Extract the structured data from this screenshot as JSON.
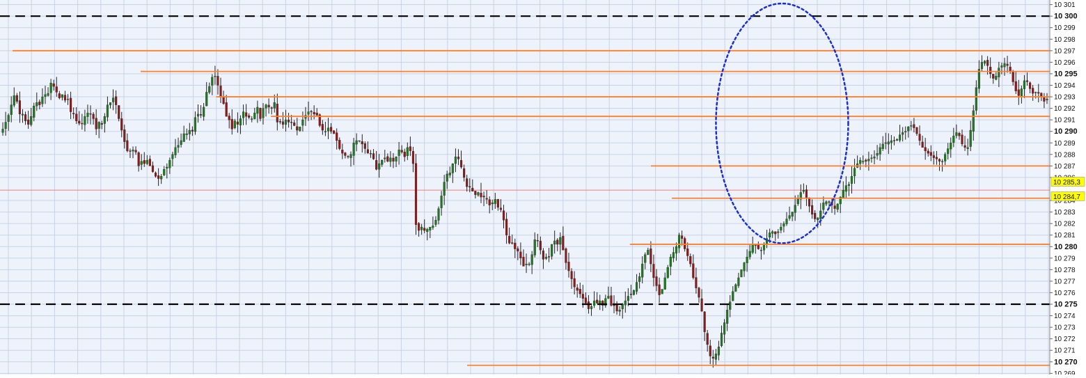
{
  "chart_data": {
    "type": "candlestick",
    "title": "",
    "xlabel": "",
    "ylabel": "",
    "ylim": [
      10268.9,
      10301.4
    ],
    "y_ticks": [
      {
        "value": 10301,
        "label": "10 301",
        "bold": false
      },
      {
        "value": 10300,
        "label": "10 300",
        "bold": true
      },
      {
        "value": 10299,
        "label": "10 299",
        "bold": false
      },
      {
        "value": 10298,
        "label": "10 298",
        "bold": false
      },
      {
        "value": 10297,
        "label": "10 297",
        "bold": false
      },
      {
        "value": 10296,
        "label": "10 296",
        "bold": false
      },
      {
        "value": 10295,
        "label": "10 295",
        "bold": true
      },
      {
        "value": 10294,
        "label": "10 294",
        "bold": false
      },
      {
        "value": 10293,
        "label": "10 293",
        "bold": false
      },
      {
        "value": 10292,
        "label": "10 292",
        "bold": false
      },
      {
        "value": 10291,
        "label": "10 291",
        "bold": false
      },
      {
        "value": 10290,
        "label": "10 290",
        "bold": true
      },
      {
        "value": 10289,
        "label": "10 289",
        "bold": false
      },
      {
        "value": 10288,
        "label": "10 288",
        "bold": false
      },
      {
        "value": 10287,
        "label": "10 287",
        "bold": false
      },
      {
        "value": 10286,
        "label": "10 286",
        "bold": false
      },
      {
        "value": 10284,
        "label": "10 284",
        "bold": false
      },
      {
        "value": 10283,
        "label": "10 283",
        "bold": false
      },
      {
        "value": 10282,
        "label": "10 282",
        "bold": false
      },
      {
        "value": 10281,
        "label": "10 281",
        "bold": false
      },
      {
        "value": 10280,
        "label": "10 280",
        "bold": true
      },
      {
        "value": 10279,
        "label": "10 279",
        "bold": false
      },
      {
        "value": 10278,
        "label": "10 278",
        "bold": false
      },
      {
        "value": 10277,
        "label": "10 277",
        "bold": false
      },
      {
        "value": 10276,
        "label": "10 276",
        "bold": false
      },
      {
        "value": 10275,
        "label": "10 275",
        "bold": true
      },
      {
        "value": 10274,
        "label": "10 274",
        "bold": false
      },
      {
        "value": 10273,
        "label": "10 273",
        "bold": false
      },
      {
        "value": 10272,
        "label": "10 272",
        "bold": false
      },
      {
        "value": 10271,
        "label": "10 271",
        "bold": false
      },
      {
        "value": 10270,
        "label": "10 270",
        "bold": true
      },
      {
        "value": 10269,
        "label": "10 269",
        "bold": false
      }
    ],
    "price_markers": [
      {
        "value": 10285.3,
        "label": "10 285,3"
      },
      {
        "value": 10284.7,
        "label": "10 284,7"
      }
    ],
    "dashed_levels": [
      10300,
      10275
    ],
    "horizontal_levels": [
      {
        "value": 10297,
        "x_start_frac": 0.012
      },
      {
        "value": 10295.2,
        "x_start_frac": 0.134
      },
      {
        "value": 10293,
        "x_start_frac": 0.206
      },
      {
        "value": 10291.3,
        "x_start_frac": 0.258
      },
      {
        "value": 10287,
        "x_start_frac": 0.62
      },
      {
        "value": 10284.2,
        "x_start_frac": 0.64
      },
      {
        "value": 10280.2,
        "x_start_frac": 0.6
      },
      {
        "value": 10269.7,
        "x_start_frac": 0.445
      }
    ],
    "price_line": 10284.9,
    "ellipse": {
      "x_center_frac": 0.745,
      "y_center": 10290.7,
      "x_radius_frac": 0.063,
      "y_radius": 10.4
    },
    "colors": {
      "background": "#eef2fb",
      "grid": "#c8d2e6",
      "level": "#ff7f2a",
      "dashed": "#000000",
      "ellipse": "#1a2fd6",
      "up": "#1d7a1d",
      "down": "#8b1a1a",
      "wick": "#222222",
      "marker_bg": "#ffff00",
      "price_line": "#e88080"
    },
    "candles": {
      "count": 380,
      "close": [
        10290.2,
        10290.8,
        10291.4,
        10292.3,
        10293.1,
        10292.6,
        10291.5,
        10291.5,
        10290.9,
        10290.6,
        10291.3,
        10292.2,
        10292.5,
        10292.3,
        10293.0,
        10293.2,
        10293.3,
        10294.2,
        10293.9,
        10293.4,
        10292.9,
        10293.2,
        10292.7,
        10292.8,
        10291.7,
        10291.5,
        10290.9,
        10290.7,
        10290.7,
        10291.3,
        10291.6,
        10291.5,
        10291.1,
        10290.2,
        10290.8,
        10290.6,
        10291.3,
        10292.3,
        10292.5,
        10292.9,
        10292.3,
        10291.1,
        10290.1,
        10289.1,
        10288.3,
        10288.3,
        10288.4,
        10288.2,
        10287.0,
        10287.4,
        10287.2,
        10287.5,
        10287.0,
        10286.5,
        10286.1,
        10285.9,
        10286.1,
        10286.7,
        10286.9,
        10287.5,
        10288.0,
        10288.6,
        10288.8,
        10289.2,
        10289.8,
        10289.8,
        10290.1,
        10290.0,
        10291.2,
        10291.5,
        10291.4,
        10292.1,
        10293.4,
        10293.9,
        10294.7,
        10294.8,
        10294.0,
        10293.0,
        10292.4,
        10291.3,
        10291.0,
        10290.2,
        10290.9,
        10290.6,
        10291.1,
        10291.7,
        10291.3,
        10291.2,
        10291.1,
        10291.6,
        10292.1,
        10291.1,
        10292.0,
        10292.3,
        10292.1,
        10292.0,
        10292.5,
        10290.8,
        10290.8,
        10290.6,
        10291.0,
        10290.8,
        10290.8,
        10290.5,
        10290.1,
        10290.4,
        10291.0,
        10291.4,
        10291.7,
        10291.7,
        10291.5,
        10291.4,
        10290.5,
        10290.1,
        10290.0,
        10290.3,
        10290.0,
        10289.8,
        10289.2,
        10288.5,
        10288.1,
        10287.9,
        10287.8,
        10288.0,
        10289.0,
        10289.2,
        10289.2,
        10288.9,
        10288.5,
        10288.1,
        10288.1,
        10287.6,
        10286.7,
        10287.2,
        10287.5,
        10287.7,
        10287.4,
        10287.7,
        10287.4,
        10287.8,
        10288.4,
        10288.2,
        10287.8,
        10288.6,
        10288.3,
        10287.2,
        10281.9,
        10281.4,
        10281.7,
        10281.4,
        10281.5,
        10281.7,
        10281.8,
        10282.3,
        10283.3,
        10284.4,
        10285.6,
        10286.3,
        10286.4,
        10287.2,
        10287.8,
        10287.6,
        10286.9,
        10286.0,
        10285.2,
        10285.2,
        10284.8,
        10284.5,
        10284.7,
        10284.3,
        10284.3,
        10284.1,
        10283.6,
        10283.8,
        10284.1,
        10283.4,
        10283.2,
        10282.3,
        10281.0,
        10280.3,
        10280.3,
        10279.8,
        10279.6,
        10279.0,
        10278.3,
        10278.5,
        10278.5,
        10279.3,
        10280.6,
        10280.5,
        10279.7,
        10278.9,
        10279.1,
        10279.1,
        10280.2,
        10280.5,
        10280.2,
        10280.8,
        10279.7,
        10278.6,
        10277.9,
        10277.2,
        10276.5,
        10276.2,
        10275.9,
        10275.5,
        10275.1,
        10274.6,
        10274.8,
        10275.3,
        10275.1,
        10275.3,
        10274.9,
        10275.5,
        10275.7,
        10274.9,
        10274.9,
        10274.4,
        10274.5,
        10275.0,
        10275.3,
        10275.7,
        10275.9,
        10276.2,
        10276.9,
        10277.4,
        10278.5,
        10279.3,
        10279.7,
        10278.5,
        10277.3,
        10276.6,
        10275.8,
        10276.3,
        10277.3,
        10278.2,
        10279.1,
        10279.5,
        10280.0,
        10281.0,
        10280.7,
        10279.8,
        10279.2,
        10278.5,
        10277.3,
        10276.4,
        10275.6,
        10274.4,
        10272.6,
        10271.5,
        10270.5,
        10270.3,
        10270.7,
        10271.3,
        10272.5,
        10273.4,
        10274.5,
        10275.2,
        10276.1,
        10276.7,
        10277.3,
        10278.0,
        10278.6,
        10279.1,
        10279.6,
        10280.2,
        10280.1,
        10279.8,
        10279.7,
        10280.2,
        10280.7,
        10281.2,
        10281.3,
        10281.1,
        10281.3,
        10281.7,
        10282.0,
        10282.4,
        10282.7,
        10283.0,
        10283.6,
        10284.2,
        10284.7,
        10284.9,
        10284.2,
        10283.5,
        10282.8,
        10282.4,
        10282.5,
        10283.1,
        10283.8,
        10283.9,
        10283.9,
        10283.6,
        10283.3,
        10283.7,
        10284.3,
        10284.9,
        10285.3,
        10285.4,
        10286.1,
        10286.8,
        10287.2,
        10287.5,
        10287.4,
        10287.4,
        10287.6,
        10287.7,
        10287.8,
        10288.1,
        10288.6,
        10288.9,
        10289.0,
        10289.1,
        10289.2,
        10289.2,
        10289.3,
        10289.7,
        10289.9,
        10290.0,
        10290.4,
        10290.5,
        10290.3,
        10289.8,
        10289.2,
        10288.6,
        10288.3,
        10288.1,
        10287.9,
        10287.7,
        10287.6,
        10287.4,
        10287.4,
        10288.0,
        10288.5,
        10289.0,
        10289.6,
        10289.9,
        10289.6,
        10288.9,
        10288.6,
        10288.6,
        10290.1,
        10291.8,
        10293.8,
        10295.4,
        10296.0,
        10296.1,
        10295.7,
        10295.0,
        10294.6,
        10294.8,
        10295.5,
        10295.7,
        10295.9,
        10295.7,
        10295.2,
        10294.3,
        10293.5,
        10293.1,
        10293.7,
        10294.4,
        10294.3,
        10293.7,
        10293.3,
        10293.4,
        10293.3,
        10293.0,
        10292.6,
        10292.8
      ],
      "ohlc_note": ""
    }
  }
}
